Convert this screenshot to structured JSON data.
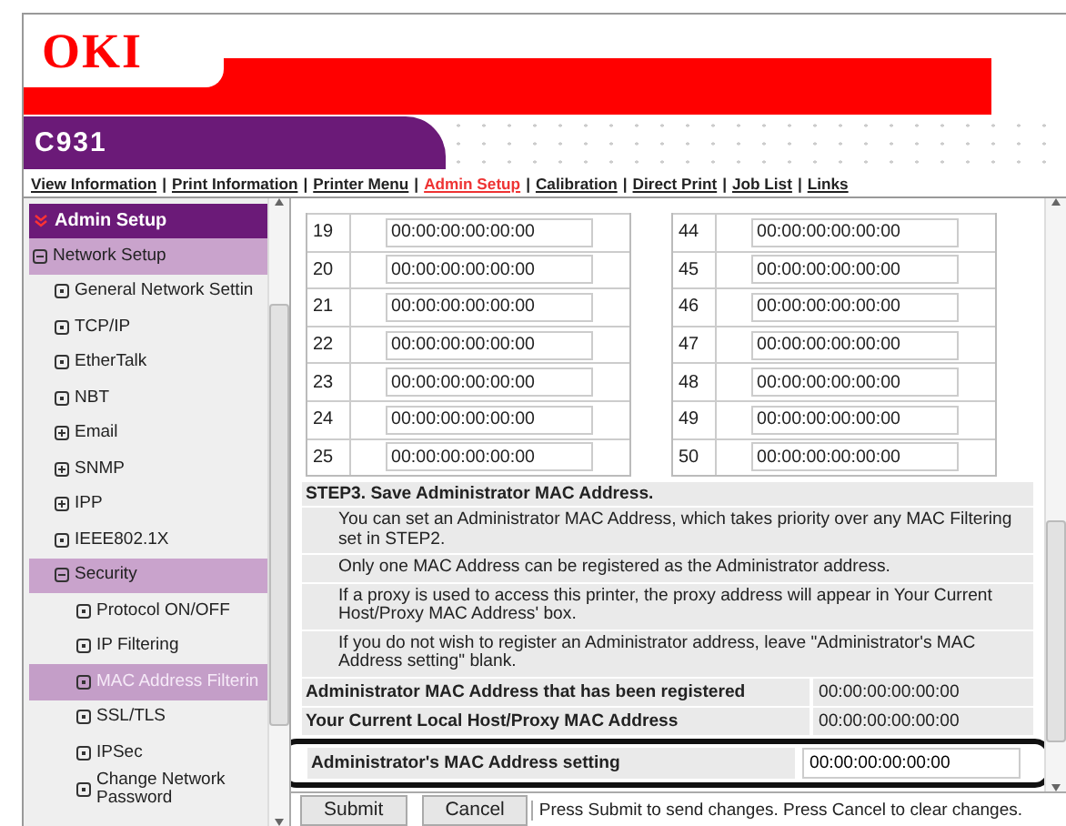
{
  "brand": {
    "logo": "OKI",
    "model": "C931"
  },
  "nav": [
    {
      "label": "View Information",
      "selected": false
    },
    {
      "separator": "|",
      "label": "Print Information",
      "selected": false
    },
    {
      "separator": "|",
      "label": "Printer Menu",
      "selected": false
    },
    {
      "separator": "|",
      "label": "Admin Setup",
      "selected": true
    },
    {
      "separator": "|",
      "label": "Calibration",
      "selected": false
    },
    {
      "separator": "|",
      "label": "Direct Print",
      "selected": false
    },
    {
      "separator": "|",
      "label": "Job List",
      "selected": false
    },
    {
      "separator": "|",
      "label": "Links",
      "selected": false
    }
  ],
  "sidebar": {
    "title": "Admin Setup",
    "tree": [
      {
        "label": "Network Setup",
        "kind": "folder",
        "expanded": true,
        "selected": false,
        "children": [
          {
            "label": "General Network Settin",
            "kind": "leaf",
            "selected": false
          },
          {
            "label": "TCP/IP",
            "kind": "leaf",
            "selected": false
          },
          {
            "label": "EtherTalk",
            "kind": "leaf",
            "selected": false
          },
          {
            "label": "NBT",
            "kind": "leaf",
            "selected": false
          },
          {
            "label": "Email",
            "kind": "folder",
            "expanded": false,
            "selected": false
          },
          {
            "label": "SNMP",
            "kind": "folder",
            "expanded": false,
            "selected": false
          },
          {
            "label": "IPP",
            "kind": "folder",
            "expanded": false,
            "selected": false
          },
          {
            "label": "IEEE802.1X",
            "kind": "leaf",
            "selected": false
          },
          {
            "label": "Security",
            "kind": "folder",
            "expanded": true,
            "selected": false,
            "children": [
              {
                "label": "Protocol ON/OFF",
                "kind": "leaf",
                "selected": false
              },
              {
                "label": "IP Filtering",
                "kind": "leaf",
                "selected": false
              },
              {
                "label": "MAC Address Filterin",
                "kind": "leaf",
                "selected": true
              },
              {
                "label": "SSL/TLS",
                "kind": "leaf",
                "selected": false
              },
              {
                "label": "IPSec",
                "kind": "leaf",
                "selected": false
              },
              {
                "label": "Change Network Password",
                "kind": "leaf",
                "selected": false
              }
            ]
          }
        ]
      }
    ]
  },
  "mac_tables": [
    [
      {
        "no": "19",
        "value": "00:00:00:00:00:00"
      },
      {
        "no": "20",
        "value": "00:00:00:00:00:00"
      },
      {
        "no": "21",
        "value": "00:00:00:00:00:00"
      },
      {
        "no": "22",
        "value": "00:00:00:00:00:00"
      },
      {
        "no": "23",
        "value": "00:00:00:00:00:00"
      },
      {
        "no": "24",
        "value": "00:00:00:00:00:00"
      },
      {
        "no": "25",
        "value": "00:00:00:00:00:00"
      }
    ],
    [
      {
        "no": "44",
        "value": "00:00:00:00:00:00"
      },
      {
        "no": "45",
        "value": "00:00:00:00:00:00"
      },
      {
        "no": "46",
        "value": "00:00:00:00:00:00"
      },
      {
        "no": "47",
        "value": "00:00:00:00:00:00"
      },
      {
        "no": "48",
        "value": "00:00:00:00:00:00"
      },
      {
        "no": "49",
        "value": "00:00:00:00:00:00"
      },
      {
        "no": "50",
        "value": "00:00:00:00:00:00"
      }
    ]
  ],
  "step3": {
    "title": "STEP3.  Save Administrator MAC Address.",
    "notes": [
      "You can set an Administrator MAC Address, which takes priority over any MAC Filtering set in STEP2.",
      "Only one MAC Address can be registered as the Administrator address.",
      "If a proxy is used to access this printer, the proxy address will appear in Your Current Host/Proxy MAC Address' box.",
      "If you do not wish to register an Administrator address, leave \"Administrator's MAC Address setting\" blank."
    ],
    "info_rows": [
      {
        "label": "Administrator MAC Address that has been registered",
        "value": "00:00:00:00:00:00"
      },
      {
        "label": "Your Current Local Host/Proxy MAC Address",
        "value": "00:00:00:00:00:00"
      }
    ],
    "setting": {
      "label": "Administrator's MAC Address setting",
      "value": "00:00:00:00:00:00"
    }
  },
  "actions": {
    "buttons": [
      "Submit",
      "Cancel"
    ],
    "hint": "Press Submit to send changes. Press Cancel to clear changes."
  }
}
